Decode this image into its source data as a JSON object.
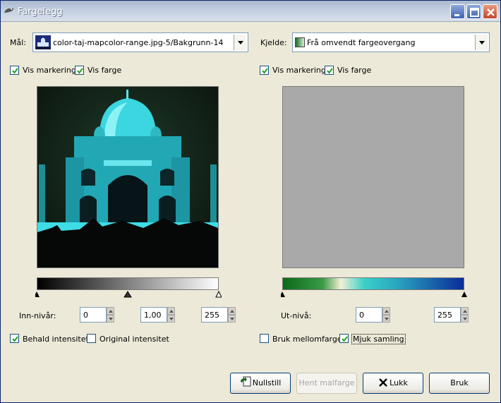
{
  "window": {
    "title": "Fargelegg"
  },
  "left": {
    "target_label": "Mål:",
    "target_value": "color-taj-mapcolor-range.jpg-5/Bakgrunn-14",
    "show_selection": "Vis markering",
    "show_color": "Vis farge",
    "input_levels_label": "Inn-nivår:",
    "in_low": "0",
    "in_gamma": "1,00",
    "in_high": "255",
    "keep_intensity": "Behald intensitet",
    "original_intensity": "Original intensitet",
    "checks": {
      "show_selection": true,
      "show_color": true,
      "keep_intensity": true,
      "original_intensity": false
    }
  },
  "right": {
    "source_label": "Kjelde:",
    "source_value": "Frå omvendt fargeovergang",
    "show_selection": "Vis markering",
    "show_color": "Vis farge",
    "output_levels_label": "Ut-nivå:",
    "out_low": "0",
    "out_high": "255",
    "use_subcolors": "Bruk mellomfarger",
    "smooth_sampling": "Mjuk samling",
    "checks": {
      "show_selection": true,
      "show_color": true,
      "use_subcolors": false,
      "smooth_sampling": true
    }
  },
  "buttons": {
    "reset": "Nullstill",
    "get_template": "Hent malfarge",
    "close": "Lukk",
    "apply": "Bruk"
  },
  "colors": {
    "preview_gray": "#a9a9a9",
    "accent_blue": "#0a246a",
    "checkbox_green": "#21a121",
    "gradient": [
      "#0c6a1a",
      "#f2f0d6",
      "#3ad0c8",
      "#0a2c9a"
    ]
  },
  "icons": {
    "window": "gimp-wilber-icon",
    "reset": "reset-icon",
    "close": "close-x-icon"
  }
}
